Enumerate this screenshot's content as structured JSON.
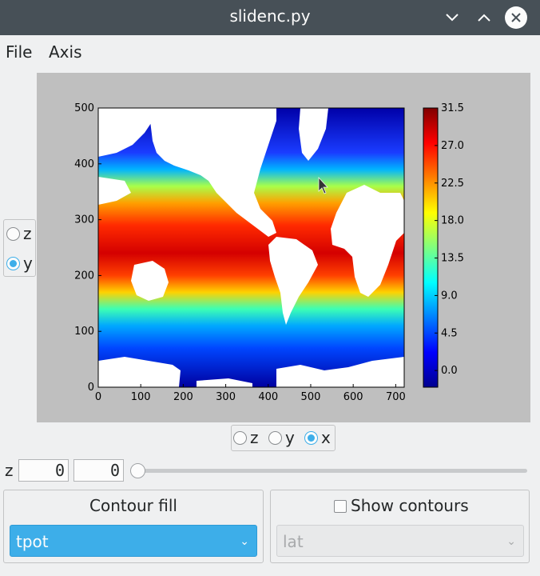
{
  "window": {
    "title": "slidenc.py",
    "minimize_icon": "chevron-down-icon",
    "maximize_icon": "chevron-up-icon",
    "close_icon": "close-icon"
  },
  "menu": {
    "items": [
      "File",
      "Axis"
    ]
  },
  "plot": {
    "type": "heatmap",
    "x_ticks": [
      "0",
      "100",
      "200",
      "300",
      "400",
      "500",
      "600",
      "700"
    ],
    "y_ticks": [
      "0",
      "100",
      "200",
      "300",
      "400",
      "500"
    ],
    "colorbar_ticks": [
      "0.0",
      "4.5",
      "9.0",
      "13.5",
      "18.0",
      "22.5",
      "27.0",
      "31.5"
    ]
  },
  "chart_data": {
    "type": "heatmap",
    "xlim": [
      0,
      720
    ],
    "ylim": [
      0,
      500
    ],
    "x_ticks": [
      0,
      100,
      200,
      300,
      400,
      500,
      600,
      700
    ],
    "y_ticks": [
      0,
      100,
      200,
      300,
      400,
      500
    ],
    "colorbar": {
      "min": -2,
      "max": 31.5,
      "ticks": [
        0.0,
        4.5,
        9.0,
        13.5,
        18.0,
        22.5,
        27.0,
        31.5
      ],
      "colormap": "jet"
    },
    "grid": false
  },
  "left_axis_selector": {
    "options": [
      "z",
      "y"
    ],
    "selected": "y"
  },
  "bottom_axis_selector": {
    "options": [
      "z",
      "y",
      "x"
    ],
    "selected": "x"
  },
  "slider_row": {
    "label": "z",
    "value1": "0",
    "value2": "0",
    "slider_value": 0
  },
  "contour_fill": {
    "title": "Contour fill",
    "selected": "tpot"
  },
  "contours": {
    "checkbox_label": "Show contours",
    "checked": false,
    "selected": "lat"
  },
  "colors": {
    "titlebar": "#475057",
    "accent": "#3daee9",
    "plot_bg": "#bfbfbf"
  }
}
